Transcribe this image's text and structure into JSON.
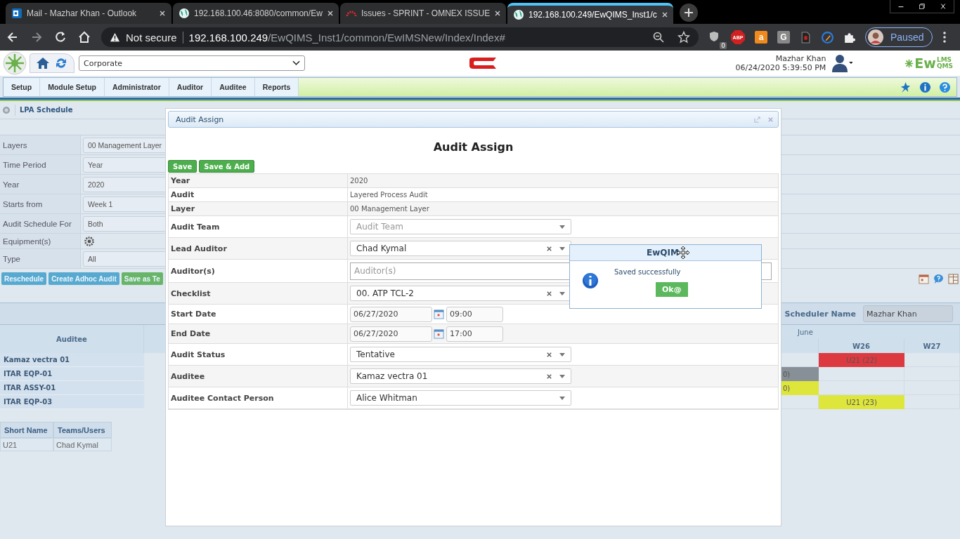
{
  "browser": {
    "tabs": [
      {
        "title": "Mail - Mazhar Khan - Outlook",
        "kind": "mail",
        "selected": false
      },
      {
        "title": "192.168.100.46:8080/common/Ew",
        "kind": "globe",
        "selected": false
      },
      {
        "title": "Issues - SPRINT - OMNEX ISSUE",
        "kind": "gauge",
        "selected": false
      },
      {
        "title": "192.168.100.249/EwQIMS_Inst1/c",
        "kind": "globe",
        "selected": true
      }
    ],
    "security": "Not secure",
    "host": "192.168.100.249",
    "path": "/EwQIMS_Inst1/common/EwIMSNew/Index/Index#",
    "extensions": [
      {
        "kind": "shield",
        "label": "0"
      },
      {
        "kind": "abp",
        "label": "ABP"
      },
      {
        "kind": "bag",
        "label": "a"
      },
      {
        "kind": "letter",
        "label": "G"
      },
      {
        "kind": "doc"
      },
      {
        "kind": "brush"
      },
      {
        "kind": "puzzle"
      }
    ],
    "profile": "Paused"
  },
  "header": {
    "org": "Corporate",
    "user": "Mazhar Khan",
    "datetime": "06/24/2020 5:39:50 PM",
    "logo": {
      "main": "Ew",
      "top": "LMS",
      "bottom": "QMS"
    }
  },
  "menu": [
    "Setup",
    "Module Setup",
    "Administrator",
    "Auditor",
    "Auditee",
    "Reports"
  ],
  "breadcrumb": "LPA Schedule",
  "filters": [
    {
      "label": "Layers",
      "kind": "select",
      "value": "00 Management Layer"
    },
    {
      "label": "Time Period",
      "kind": "select",
      "value": "Year"
    },
    {
      "label": "Year",
      "kind": "select",
      "value": "2020"
    },
    {
      "label": "Starts from",
      "kind": "select",
      "value": "Week 1"
    },
    {
      "label": "Audit Schedule For",
      "kind": "select",
      "value": "Both"
    },
    {
      "label": "Equipment(s)",
      "kind": "icon"
    },
    {
      "label": "Type",
      "kind": "select",
      "value": "All"
    }
  ],
  "actions": [
    {
      "label": "Reschedule",
      "kind": "info"
    },
    {
      "label": "Create Adhoc Audit",
      "kind": "info"
    },
    {
      "label": "Save as Te",
      "kind": "success"
    }
  ],
  "scheduler": {
    "label": "Scheduler Name",
    "value": "Mazhar Khan"
  },
  "schedule": {
    "auditee_header": "Auditee",
    "month": "June",
    "weeks": [
      "W26",
      "W27"
    ],
    "rows": [
      {
        "auditee": "Kamaz vectra 01",
        "cells": [
          null,
          {
            "text": "U21 (22)",
            "color": "#dc3a40"
          },
          null
        ]
      },
      {
        "auditee": "ITAR EQP-01",
        "cells": [
          {
            "text": "0)",
            "color": "#878f97"
          },
          null,
          null
        ]
      },
      {
        "auditee": "ITAR ASSY-01",
        "cells": [
          {
            "text": "0)",
            "color": "#dee63c"
          },
          null,
          null
        ]
      },
      {
        "auditee": "ITAR EQP-03",
        "cells": [
          null,
          {
            "text": "U21 (23)",
            "color": "#dee63c"
          },
          null
        ]
      }
    ]
  },
  "teams": {
    "columns": [
      "Short Name",
      "Teams/Users"
    ],
    "rows": [
      [
        "U21",
        "Chad Kymal"
      ]
    ]
  },
  "modal": {
    "title": "Audit Assign",
    "heading": "Audit Assign",
    "buttons": [
      "Save",
      "Save & Add"
    ],
    "fields": [
      {
        "label": "Year",
        "kind": "static",
        "value": "2020"
      },
      {
        "label": "Audit",
        "kind": "static",
        "value": "Layered Process Audit"
      },
      {
        "label": "Layer",
        "kind": "static",
        "value": "00 Management Layer"
      },
      {
        "label": "Audit Team",
        "kind": "select",
        "placeholder": "Audit Team",
        "clearable": false
      },
      {
        "label": "Lead Auditor",
        "kind": "select",
        "value": "Chad Kymal",
        "clearable": true
      },
      {
        "label": "Auditor(s)",
        "kind": "multi",
        "placeholder": "Auditor(s)"
      },
      {
        "label": "Checklist",
        "kind": "select",
        "value": "00. ATP TCL-2",
        "clearable": true
      },
      {
        "label": "Start Date",
        "kind": "datetime",
        "date": "06/27/2020",
        "time": "09:00"
      },
      {
        "label": "End Date",
        "kind": "datetime",
        "date": "06/27/2020",
        "time": "17:00"
      },
      {
        "label": "Audit Status",
        "kind": "select",
        "value": "Tentative",
        "clearable": true
      },
      {
        "label": "Auditee",
        "kind": "select",
        "value": "Kamaz vectra 01",
        "clearable": true
      },
      {
        "label": "Auditee Contact Person",
        "kind": "select",
        "value": "Alice Whitman",
        "clearable": false
      }
    ]
  },
  "alert": {
    "title": "EwQIM",
    "message": "Saved successfully",
    "button": "Ok@"
  }
}
